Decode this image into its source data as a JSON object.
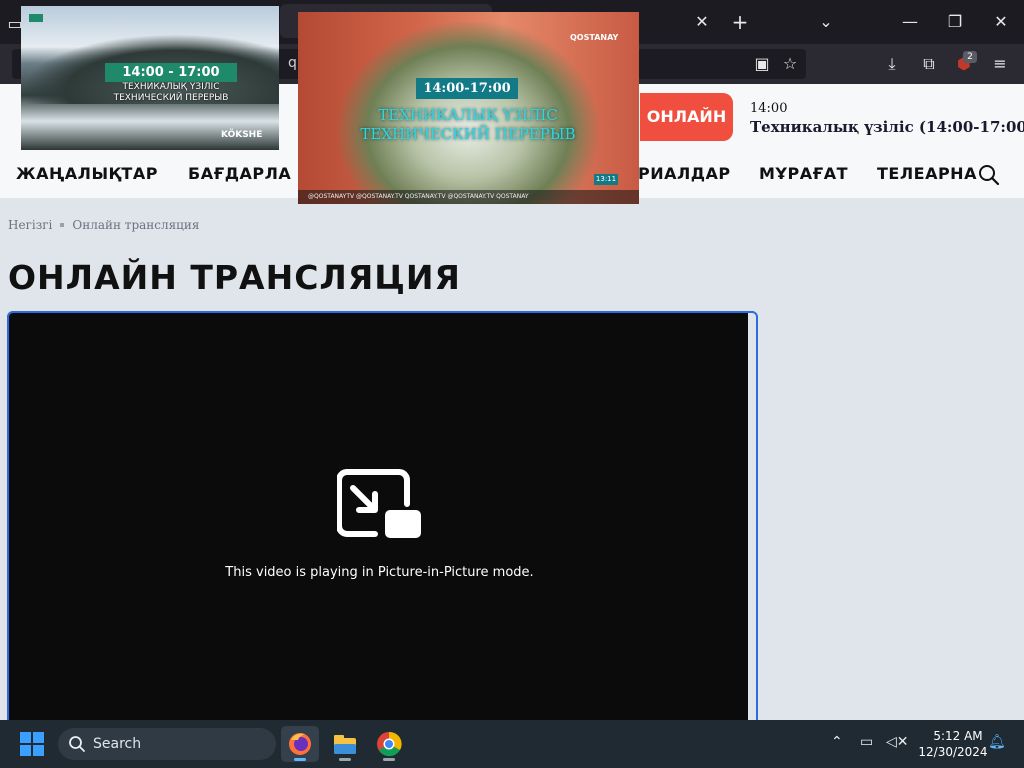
{
  "browser": {
    "url_fragment": "q",
    "extension_badge": "2",
    "icons": [
      "tab-list-icon",
      "new-tab-icon",
      "chevron-down-icon",
      "minimize-icon",
      "restore-icon",
      "close-icon",
      "pip-toggle-icon",
      "bookmark-star-icon",
      "download-icon",
      "extensions-icon",
      "ublock-icon",
      "menu-icon"
    ]
  },
  "site": {
    "online_button": "ОНЛАЙН",
    "schedule": {
      "time": "14:00",
      "title": "Техникалық үзіліс (14:00-17:00)"
    },
    "menu": [
      "ЖАҢАЛЫҚТАР",
      "БАҒДАРЛА",
      "РИАЛДАР",
      "МҰРАҒАТ",
      "ТЕЛЕАРНА"
    ],
    "breadcrumb": {
      "home": "Негізгі",
      "current": "Онлайн трансляция"
    },
    "page_title": "ОНЛАЙН ТРАНСЛЯЦИЯ",
    "accent_color": "#f04e3e"
  },
  "player": {
    "message": "This video is playing in Picture-in-Picture mode."
  },
  "pip_windows": [
    {
      "time": "14:00 - 17:00",
      "caption_line1": "ТЕХНИКАЛЫҚ ҮЗІЛІС",
      "caption_line2": "ТЕХНИЧЕСКИЙ ПЕРЕРЫВ",
      "logo": "KÖKSHE"
    },
    {
      "time": "14:00-17:00",
      "caption_line1": "ТЕХНИКАЛЫҚ ҮЗІЛІС",
      "caption_line2": "ТЕХНИЧЕСКИЙ ПЕРЕРЫВ",
      "logo": "QOSTANAY",
      "clock": "13:11",
      "footer": "@QOSTANAYTV  @QOSTANAY.TV  QOSTANAY.TV  @QOSTANAY.TV  QOSTANAY"
    }
  ],
  "taskbar": {
    "search_placeholder": "Search",
    "time": "5:12 AM",
    "date": "12/30/2024",
    "apps": [
      "firefox-icon",
      "file-explorer-icon",
      "chrome-icon"
    ]
  }
}
